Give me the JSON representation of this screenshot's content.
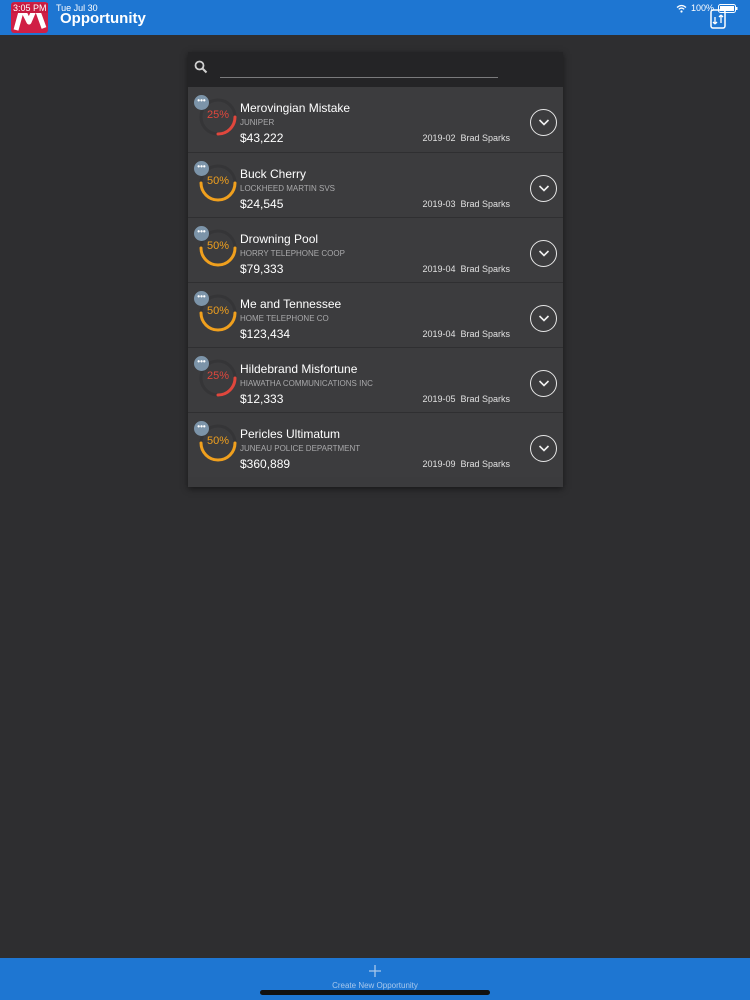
{
  "status_bar": {
    "time": "3:05 PM",
    "date": "Tue Jul 30",
    "battery": "100%"
  },
  "header": {
    "title": "Opportunity"
  },
  "search": {
    "placeholder": ""
  },
  "opportunities": [
    {
      "name": "Merovingian Mistake",
      "account": "JUNIPER",
      "amount": "$43,222",
      "period": "2019-02",
      "owner": "Brad Sparks",
      "probability_label": "25%",
      "probability": 0.25,
      "color": "#e0473d"
    },
    {
      "name": "Buck Cherry",
      "account": "LOCKHEED MARTIN SVS",
      "amount": "$24,545",
      "period": "2019-03",
      "owner": "Brad Sparks",
      "probability_label": "50%",
      "probability": 0.5,
      "color": "#f0a01e"
    },
    {
      "name": "Drowning Pool",
      "account": "HORRY TELEPHONE COOP",
      "amount": "$79,333",
      "period": "2019-04",
      "owner": "Brad Sparks",
      "probability_label": "50%",
      "probability": 0.5,
      "color": "#f0a01e"
    },
    {
      "name": "Me and Tennessee",
      "account": "HOME TELEPHONE CO",
      "amount": "$123,434",
      "period": "2019-04",
      "owner": "Brad Sparks",
      "probability_label": "50%",
      "probability": 0.5,
      "color": "#f0a01e"
    },
    {
      "name": "Hildebrand Misfortune",
      "account": "HIAWATHA COMMUNICATIONS INC",
      "amount": "$12,333",
      "period": "2019-05",
      "owner": "Brad Sparks",
      "probability_label": "25%",
      "probability": 0.25,
      "color": "#e0473d"
    },
    {
      "name": "Pericles Ultimatum",
      "account": "JUNEAU POLICE DEPARTMENT",
      "amount": "$360,889",
      "period": "2019-09",
      "owner": "Brad Sparks",
      "probability_label": "50%",
      "probability": 0.5,
      "color": "#f0a01e"
    }
  ],
  "footer": {
    "create_label": "Create New Opportunity"
  },
  "colors": {
    "header_blue": "#1e76d2",
    "background": "#2e2e30",
    "panel": "#3c3c3e",
    "brand_red": "#d01f45"
  }
}
